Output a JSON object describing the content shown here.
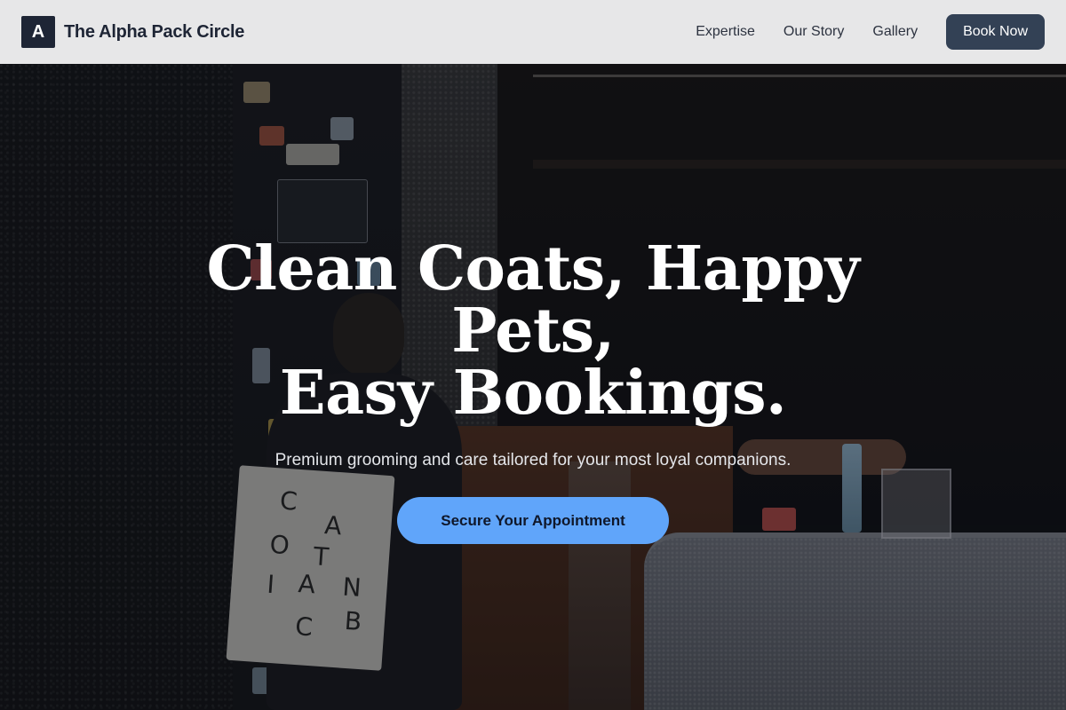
{
  "brand": {
    "logo_letter": "A",
    "name": "The Alpha Pack Circle"
  },
  "nav": {
    "links": [
      "Expertise",
      "Our Story",
      "Gallery"
    ],
    "cta_label": "Book Now"
  },
  "hero": {
    "title_line1": "Clean Coats, Happy Pets,",
    "title_line2": "Easy Bookings.",
    "subtitle": "Premium grooming and care tailored for your most loyal companions.",
    "cta_label": "Secure Your Appointment",
    "tote_letters": [
      "C",
      "A",
      "O",
      "T",
      "I",
      "A",
      "N",
      "C",
      "B"
    ]
  },
  "colors": {
    "nav_bg": "#f0f0f1",
    "brand_dark": "#1e2535",
    "book_button_bg": "#334155",
    "cta_bg": "#60a5fa"
  }
}
